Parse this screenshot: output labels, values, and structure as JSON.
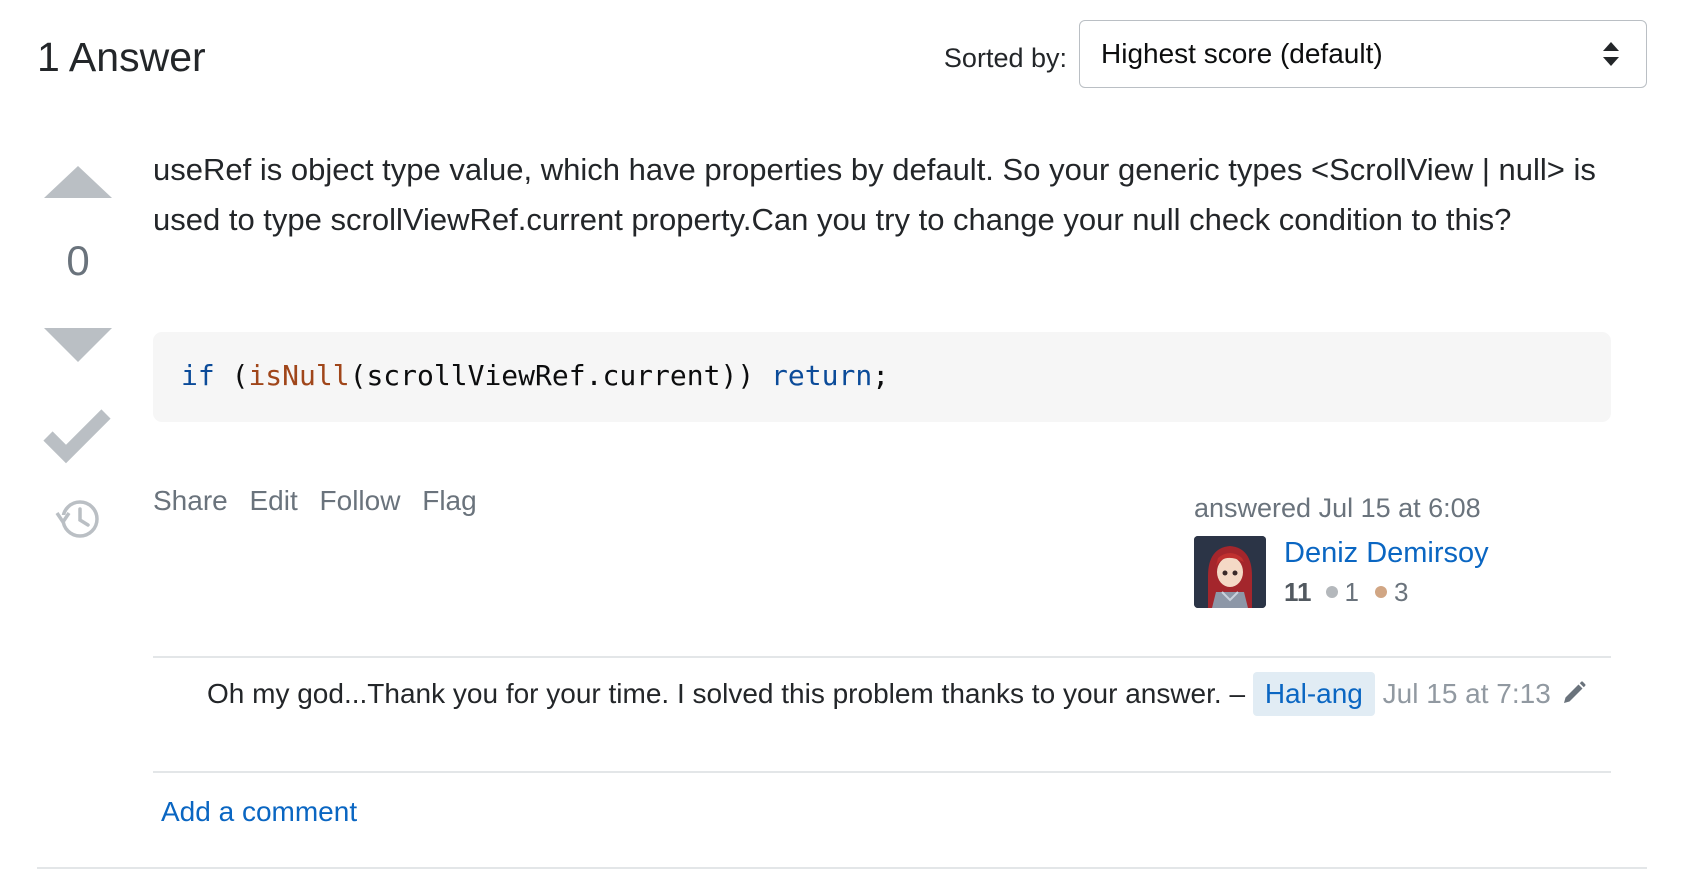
{
  "header": {
    "answer_count": "1 Answer",
    "sort_label": "Sorted by:",
    "sort_value": "Highest score (default)"
  },
  "vote": {
    "count": "0"
  },
  "post": {
    "body": "useRef is object type value, which have properties by default. So your generic types <ScrollView | null> is used to type scrollViewRef.current property.Can you try to change your null check condition to this?",
    "code": {
      "kw_if": "if",
      "paren_open": " (",
      "fn_name": "isNull",
      "args": "(scrollViewRef.current))",
      "space": " ",
      "kw_return": "return",
      "semi": ";"
    }
  },
  "post_menu": {
    "share": "Share",
    "edit": "Edit",
    "follow": "Follow",
    "flag": "Flag"
  },
  "user_card": {
    "action_time": "answered Jul 15 at 6:08",
    "name": "Deniz Demirsoy",
    "reputation": "11",
    "silver_badges": "1",
    "bronze_badges": "3"
  },
  "comment": {
    "text": "Oh my god...Thank you for your time. I solved this problem thanks to your answer. – ",
    "user": "Hal-ang",
    "date": "Jul 15 at 7:13"
  },
  "add_comment_label": "Add a comment",
  "colors": {
    "link": "#0a66c2",
    "muted": "#6a737c",
    "vote_arrow": "#babfc4",
    "code_bg": "#f6f6f6",
    "code_keyword": "#0b4b99",
    "code_function": "#a0461a",
    "silver_badge": "#b4b8bc",
    "bronze_badge": "#d1a684"
  }
}
